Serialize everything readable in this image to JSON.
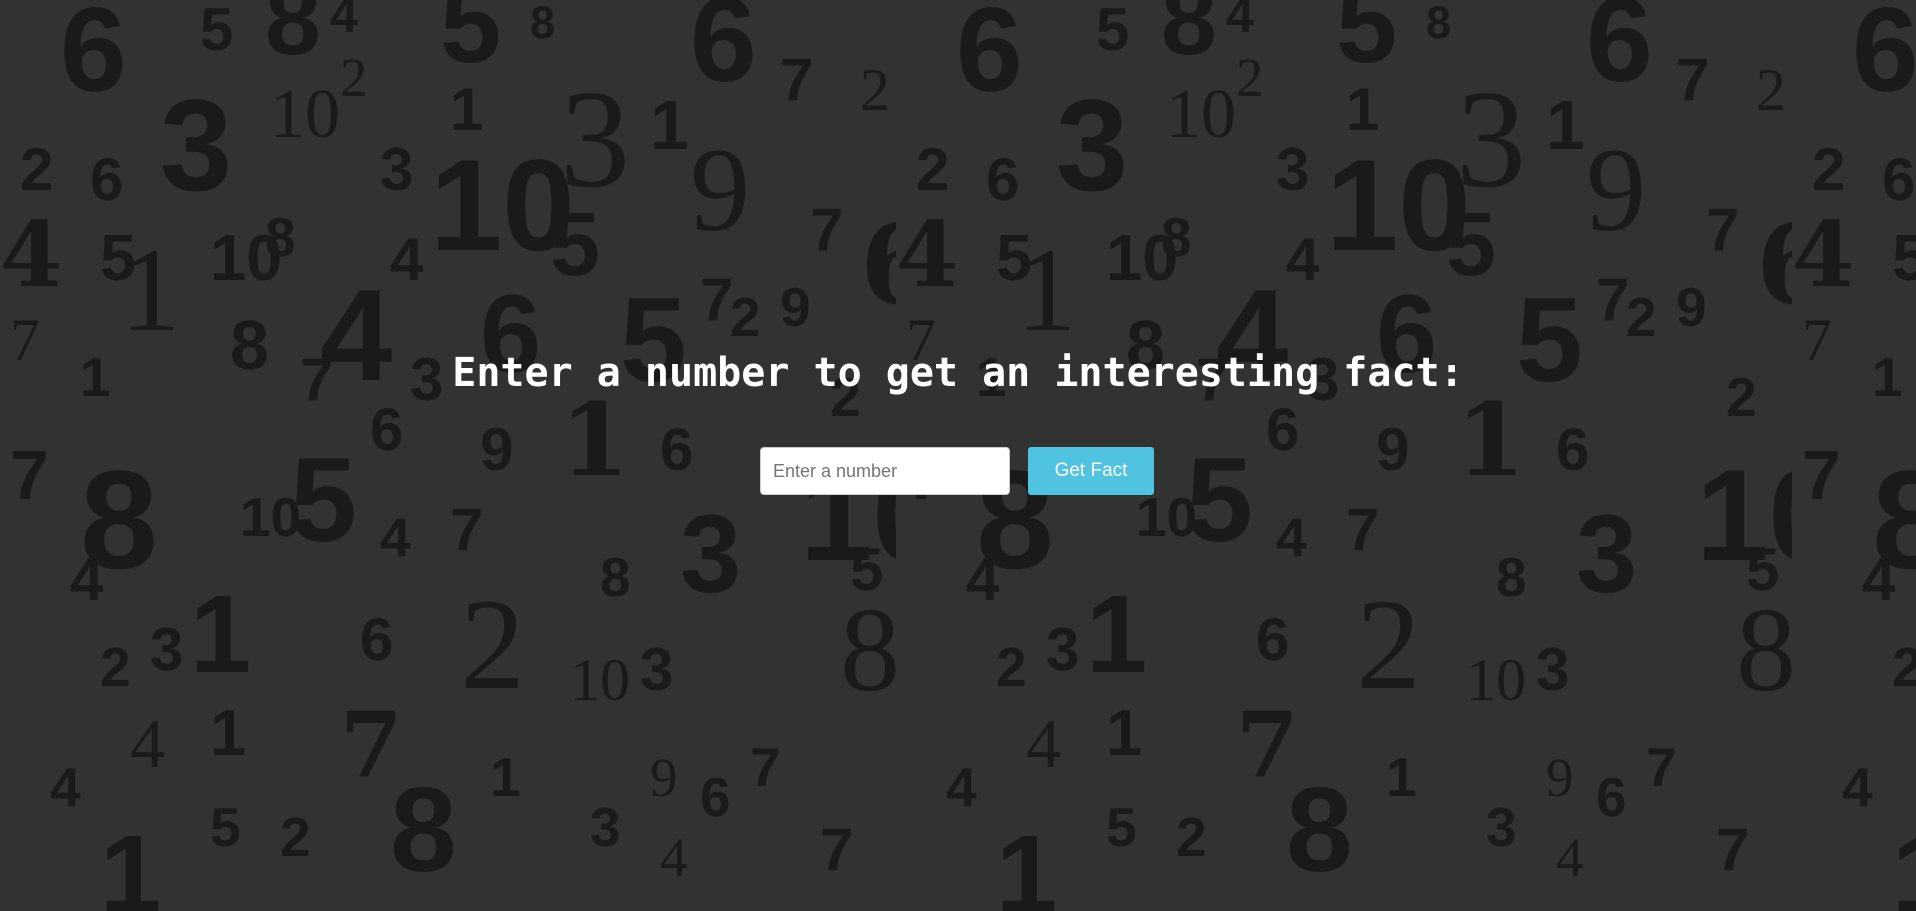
{
  "heading": "Enter a number to get an interesting fact:",
  "number_input": {
    "placeholder": "Enter a number",
    "value": ""
  },
  "get_fact_button": {
    "label": "Get Fact"
  },
  "background": {
    "numbers": [
      "6",
      "5",
      "8",
      "4",
      "5",
      "8",
      "6",
      "7",
      "2",
      "3",
      "10",
      "2",
      "1",
      "3",
      "1",
      "2",
      "6",
      "3",
      "10",
      "9",
      "7",
      "4",
      "5",
      "1",
      "10",
      "8",
      "4",
      "5",
      "7",
      "9",
      "6",
      "7",
      "8",
      "4",
      "6",
      "5",
      "2",
      "1",
      "7",
      "6",
      "3",
      "9",
      "1",
      "6",
      "10",
      "2",
      "7",
      "8",
      "10",
      "5",
      "4",
      "7",
      "8",
      "3",
      "5",
      "4",
      "2",
      "3",
      "1",
      "6",
      "2",
      "10",
      "3",
      "7",
      "8",
      "4",
      "1",
      "7",
      "1",
      "9",
      "6",
      "4",
      "5",
      "2",
      "8",
      "3",
      "4",
      "1",
      "7"
    ]
  },
  "colors": {
    "page_background": "#323232",
    "numeral_color": "#1a1a1a",
    "heading_color": "#ffffff",
    "button_background": "#4fc3e0",
    "button_text": "#ffffff"
  }
}
